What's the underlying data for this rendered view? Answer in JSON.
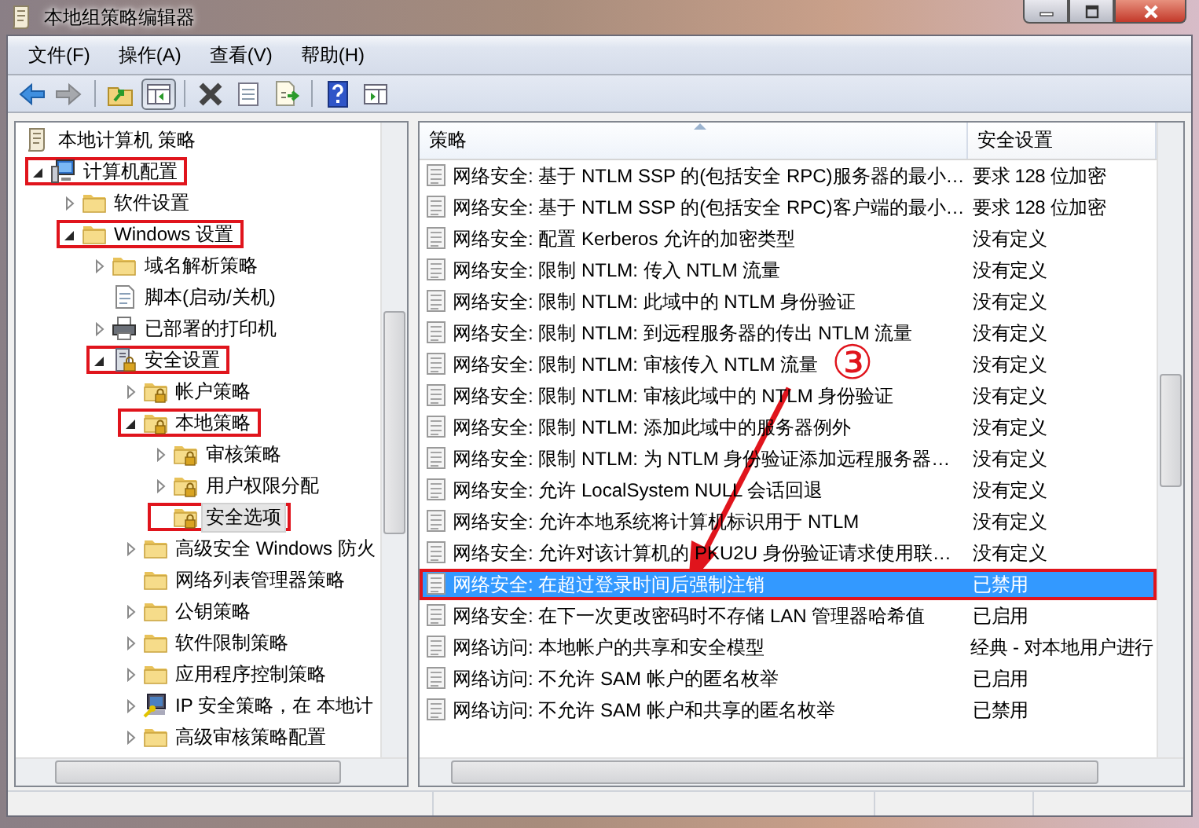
{
  "window": {
    "title": "本地组策略编辑器"
  },
  "menu": [
    "文件(F)",
    "操作(A)",
    "查看(V)",
    "帮助(H)"
  ],
  "toolbar": [
    {
      "kind": "back",
      "disabled": false,
      "pressed": false
    },
    {
      "kind": "forward",
      "disabled": true,
      "pressed": false
    },
    {
      "kind": "up",
      "disabled": false,
      "pressed": false
    },
    {
      "kind": "tree",
      "disabled": false,
      "pressed": true
    },
    {
      "kind": "delete",
      "disabled": false,
      "pressed": false
    },
    {
      "kind": "properties",
      "disabled": false,
      "pressed": false
    },
    {
      "kind": "export",
      "disabled": false,
      "pressed": false
    },
    {
      "kind": "help",
      "disabled": false,
      "pressed": false
    },
    {
      "kind": "action-pane",
      "disabled": false,
      "pressed": false
    }
  ],
  "tree": {
    "root": {
      "label": "本地计算机 策略",
      "kind": "policy",
      "highlighted": false,
      "selected": false,
      "children": [
        {
          "label": "计算机配置",
          "kind": "computer",
          "expanded": true,
          "highlighted": true,
          "selected": false,
          "children": [
            {
              "label": "软件设置",
              "kind": "folder",
              "expanded": false,
              "highlighted": false,
              "selected": false
            },
            {
              "label": "Windows 设置",
              "kind": "folder",
              "expanded": true,
              "highlighted": true,
              "selected": false,
              "children": [
                {
                  "label": "域名解析策略",
                  "kind": "folder",
                  "expanded": false,
                  "highlighted": false,
                  "selected": false
                },
                {
                  "label": "脚本(启动/关机)",
                  "kind": "script",
                  "highlighted": false,
                  "selected": false
                },
                {
                  "label": "已部署的打印机",
                  "kind": "printer",
                  "expanded": false,
                  "highlighted": false,
                  "selected": false
                },
                {
                  "label": "安全设置",
                  "kind": "security",
                  "expanded": true,
                  "highlighted": true,
                  "selected": false,
                  "children": [
                    {
                      "label": "帐户策略",
                      "kind": "lock-folder",
                      "expanded": false,
                      "highlighted": false,
                      "selected": false
                    },
                    {
                      "label": "本地策略",
                      "kind": "lock-folder",
                      "expanded": true,
                      "highlighted": true,
                      "selected": false,
                      "children": [
                        {
                          "label": "审核策略",
                          "kind": "lock-folder",
                          "expanded": false,
                          "highlighted": false,
                          "selected": false
                        },
                        {
                          "label": "用户权限分配",
                          "kind": "lock-folder",
                          "expanded": false,
                          "highlighted": false,
                          "selected": false
                        },
                        {
                          "label": "安全选项",
                          "kind": "lock-folder",
                          "highlighted": true,
                          "selected": true
                        }
                      ]
                    },
                    {
                      "label": "高级安全 Windows 防火",
                      "kind": "folder",
                      "expanded": false,
                      "highlighted": false,
                      "selected": false
                    },
                    {
                      "label": "网络列表管理器策略",
                      "kind": "folder",
                      "highlighted": false,
                      "selected": false
                    },
                    {
                      "label": "公钥策略",
                      "kind": "folder",
                      "expanded": false,
                      "highlighted": false,
                      "selected": false
                    },
                    {
                      "label": "软件限制策略",
                      "kind": "folder",
                      "expanded": false,
                      "highlighted": false,
                      "selected": false
                    },
                    {
                      "label": "应用程序控制策略",
                      "kind": "folder",
                      "expanded": false,
                      "highlighted": false,
                      "selected": false
                    },
                    {
                      "label": "IP 安全策略，在 本地计",
                      "kind": "ip-security",
                      "expanded": false,
                      "highlighted": false,
                      "selected": false
                    },
                    {
                      "label": "高级审核策略配置",
                      "kind": "folder",
                      "expanded": false,
                      "highlighted": false,
                      "selected": false
                    }
                  ]
                }
              ]
            }
          ]
        }
      ]
    }
  },
  "list": {
    "columns": [
      {
        "label": "策略",
        "sorted": true
      },
      {
        "label": "安全设置",
        "sorted": false
      }
    ],
    "rows": [
      {
        "policy": "网络安全: 基于 NTLM SSP 的(包括安全 RPC)服务器的最小…",
        "setting": "要求 128 位加密",
        "selected": false,
        "highlighted": false
      },
      {
        "policy": "网络安全: 基于 NTLM SSP 的(包括安全 RPC)客户端的最小…",
        "setting": "要求 128 位加密",
        "selected": false,
        "highlighted": false
      },
      {
        "policy": "网络安全: 配置 Kerberos 允许的加密类型",
        "setting": "没有定义",
        "selected": false,
        "highlighted": false
      },
      {
        "policy": "网络安全: 限制 NTLM: 传入 NTLM 流量",
        "setting": "没有定义",
        "selected": false,
        "highlighted": false
      },
      {
        "policy": "网络安全: 限制 NTLM: 此域中的 NTLM 身份验证",
        "setting": "没有定义",
        "selected": false,
        "highlighted": false
      },
      {
        "policy": "网络安全: 限制 NTLM: 到远程服务器的传出 NTLM 流量",
        "setting": "没有定义",
        "selected": false,
        "highlighted": false
      },
      {
        "policy": "网络安全: 限制 NTLM: 审核传入 NTLM 流量",
        "setting": "没有定义",
        "selected": false,
        "highlighted": false
      },
      {
        "policy": "网络安全: 限制 NTLM: 审核此域中的 NTLM 身份验证",
        "setting": "没有定义",
        "selected": false,
        "highlighted": false
      },
      {
        "policy": "网络安全: 限制 NTLM: 添加此域中的服务器例外",
        "setting": "没有定义",
        "selected": false,
        "highlighted": false
      },
      {
        "policy": "网络安全: 限制 NTLM: 为 NTLM 身份验证添加远程服务器…",
        "setting": "没有定义",
        "selected": false,
        "highlighted": false
      },
      {
        "policy": "网络安全: 允许 LocalSystem NULL 会话回退",
        "setting": "没有定义",
        "selected": false,
        "highlighted": false
      },
      {
        "policy": "网络安全: 允许本地系统将计算机标识用于 NTLM",
        "setting": "没有定义",
        "selected": false,
        "highlighted": false
      },
      {
        "policy": "网络安全: 允许对该计算机的 PKU2U 身份验证请求使用联…",
        "setting": "没有定义",
        "selected": false,
        "highlighted": false
      },
      {
        "policy": "网络安全: 在超过登录时间后强制注销",
        "setting": "已禁用",
        "selected": true,
        "highlighted": true
      },
      {
        "policy": "网络安全: 在下一次更改密码时不存储 LAN 管理器哈希值",
        "setting": "已启用",
        "selected": false,
        "highlighted": false
      },
      {
        "policy": "网络访问: 本地帐户的共享和安全模型",
        "setting": "经典 - 对本地用户进行",
        "selected": false,
        "highlighted": false
      },
      {
        "policy": "网络访问: 不允许 SAM 帐户的匿名枚举",
        "setting": "已启用",
        "selected": false,
        "highlighted": false
      },
      {
        "policy": "网络访问: 不允许 SAM 帐户和共享的匿名枚举",
        "setting": "已禁用",
        "selected": false,
        "highlighted": false
      }
    ]
  },
  "annotation": {
    "step": "③"
  }
}
